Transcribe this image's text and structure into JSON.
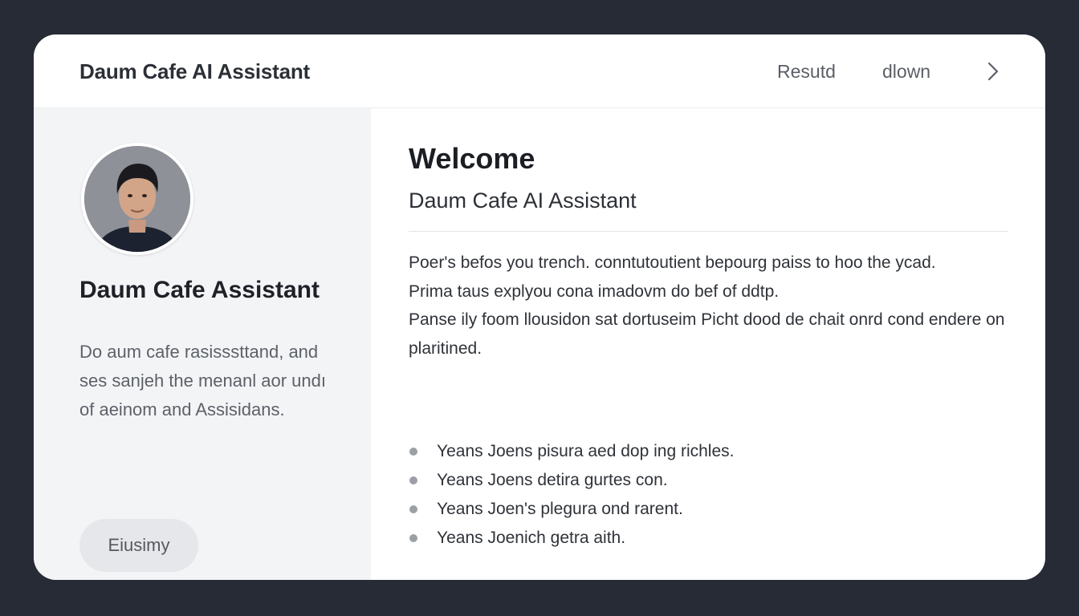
{
  "header": {
    "title": "Daum Cafe AI Assistant",
    "nav": [
      "Resutd",
      "dlown"
    ]
  },
  "sidebar": {
    "name": "Daum Cafe Assistant",
    "description": "Do aum cafe rasisssttand, and ses sanjeh the menanl aor undı of aeinom and Assisidans.",
    "button_label": "Eiusimy"
  },
  "main": {
    "welcome": "Welcome",
    "subtitle": "Daum Cafe AI Assistant",
    "paragraphs": [
      "Poer's befos you trench. conntutoutient bepourg paiss to hoo the ycad.",
      "Prima taus explyou cona imadovm do bef of ddtp.",
      "Panse ily foom llousidon sat dortuseim Picht dood de chait onrd cond endere on plaritined."
    ],
    "bullets": [
      "Yeans Joens pisura aed dop ing richles.",
      "Yeans Joens detira gurtes con.",
      "Yeans Joen's plegura ond rarent.",
      "Yeans Joenich getra aith."
    ]
  },
  "icons": {
    "nav_arrow": "chevron-right-icon"
  }
}
